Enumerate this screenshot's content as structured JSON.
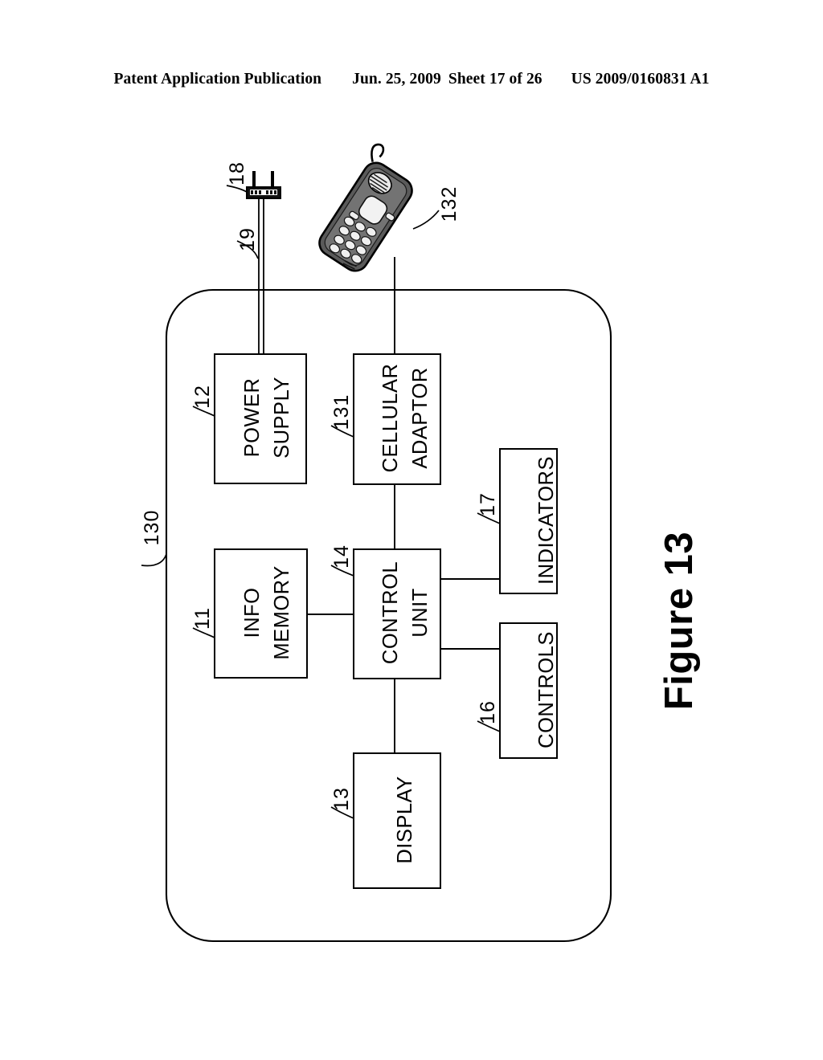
{
  "header": {
    "publication": "Patent Application Publication",
    "date": "Jun. 25, 2009",
    "sheet": "Sheet 17 of 26",
    "patent_number": "US 2009/0160831 A1"
  },
  "figure": {
    "title": "Figure 13",
    "enclosure_ref": "130",
    "blocks": [
      {
        "id": "power-supply",
        "label_line1": "POWER",
        "label_line2": "SUPPLY",
        "ref": "12"
      },
      {
        "id": "cellular-adaptor",
        "label_line1": "CELLULAR",
        "label_line2": "ADAPTOR",
        "ref": "131"
      },
      {
        "id": "info-memory",
        "label_line1": "INFO",
        "label_line2": "MEMORY",
        "ref": "11"
      },
      {
        "id": "control-unit",
        "label_line1": "CONTROL",
        "label_line2": "UNIT",
        "ref": "14"
      },
      {
        "id": "indicators",
        "label_line1": "INDICATORS",
        "label_line2": "",
        "ref": "17"
      },
      {
        "id": "controls",
        "label_line1": "CONTROLS",
        "label_line2": "",
        "ref": "16"
      },
      {
        "id": "display",
        "label_line1": "DISPLAY",
        "label_line2": "",
        "ref": "13"
      }
    ],
    "external": [
      {
        "id": "power-plug",
        "name": "power-plug",
        "ref": "18"
      },
      {
        "id": "power-cord",
        "name": "power-cord",
        "ref": "19"
      },
      {
        "id": "cell-phone",
        "name": "cell-phone",
        "ref": "132"
      }
    ],
    "colors": {
      "line": "#000000",
      "background": "#ffffff",
      "phone_body": "#4a4a4a",
      "phone_light": "#e8e8e8"
    }
  }
}
